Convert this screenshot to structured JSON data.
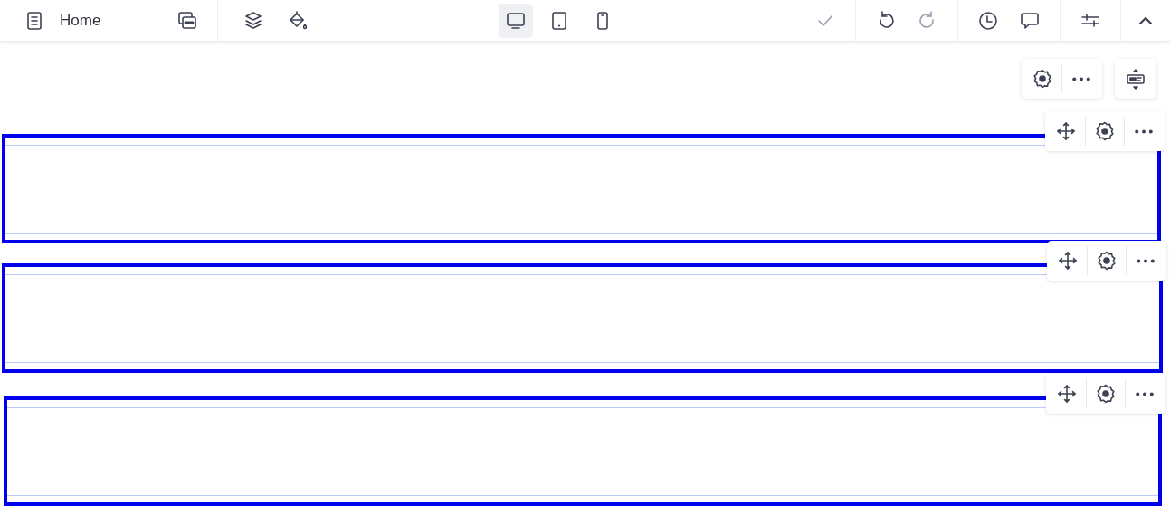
{
  "topbar": {
    "page_title": "Home",
    "devices": [
      {
        "kind": "desktop",
        "selected": true
      },
      {
        "kind": "tablet",
        "selected": false
      },
      {
        "kind": "phone",
        "selected": false
      }
    ],
    "save": {
      "disabled": true
    },
    "undo": {
      "disabled": false
    },
    "redo": {
      "disabled": true
    },
    "panel": {
      "expanded": true
    }
  },
  "sections": [
    {
      "selected": true
    },
    {
      "selected": true
    },
    {
      "selected": true
    }
  ]
}
